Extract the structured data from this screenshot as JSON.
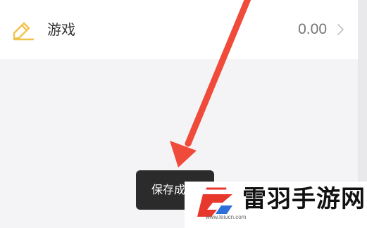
{
  "list_item": {
    "label": "游戏",
    "amount": "0.00",
    "icon": "pencil-note-icon",
    "chevron": "chevron-right-icon"
  },
  "toast": {
    "text": "保存成功"
  },
  "watermark": {
    "title": "雷羽手游网",
    "url": "www.leiucn.com",
    "logo": "leiyu-logo-icon"
  },
  "annotation": {
    "arrow": "red-arrow",
    "color": "#f04a3a"
  },
  "colors": {
    "background": "#f4f4f6",
    "icon_yellow": "#f1c24b",
    "toast_background": "#2b2b2b",
    "logo_red": "#e8372c"
  }
}
